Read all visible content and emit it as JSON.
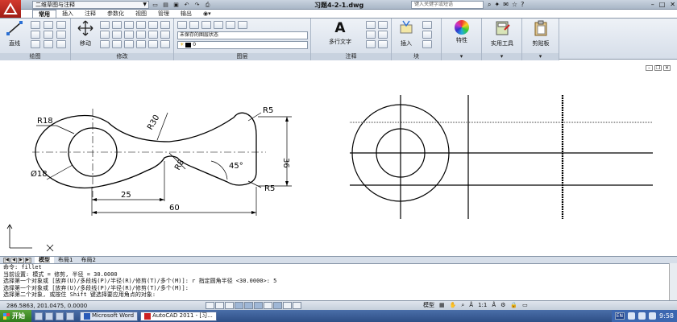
{
  "window": {
    "workspace": "二维草图与注释",
    "doc_title": "习题4-2-1.dwg",
    "search_placeholder": "键入关键字或短语"
  },
  "tabs": [
    {
      "label": "常用",
      "active": true
    },
    {
      "label": "插入",
      "active": false
    },
    {
      "label": "注释",
      "active": false
    },
    {
      "label": "参数化",
      "active": false
    },
    {
      "label": "视图",
      "active": false
    },
    {
      "label": "管理",
      "active": false
    },
    {
      "label": "输出",
      "active": false
    }
  ],
  "ribbon": {
    "draw": {
      "line_label": "直线",
      "panel_label": "绘图"
    },
    "modify": {
      "move_label": "移动",
      "panel_label": "修改"
    },
    "layers": {
      "state_value": "未保存的图层状态",
      "layer_value": "0",
      "panel_label": "图层"
    },
    "annotation": {
      "mtext_label": "多行文字",
      "panel_label": "注释"
    },
    "block": {
      "insert_label": "插入",
      "panel_label": "块"
    },
    "properties_label": "特性",
    "utilities_label": "实用工具",
    "clipboard_label": "剪贴板"
  },
  "drawing": {
    "dims": {
      "r18": "R18",
      "d18": "Ø18",
      "r30": "R30",
      "r8": "R8",
      "r5_top": "R5",
      "r5_bottom": "R5",
      "angle": "45°",
      "h36": "36",
      "w25": "25",
      "w60": "60"
    }
  },
  "layout_tabs": [
    {
      "label": "模型",
      "active": true
    },
    {
      "label": "布局1",
      "active": false
    },
    {
      "label": "布局2",
      "active": false
    }
  ],
  "command_lines": [
    "命令:  fillet",
    "当前设置: 模式 = 修剪, 半径 = 30.0000",
    "选择第一个对象或 [放弃(U)/多段线(P)/半径(R)/修剪(T)/多个(M)]: r 指定圆角半径 <30.0000>: 5",
    "选择第一个对象或 [放弃(U)/多段线(P)/半径(R)/修剪(T)/多个(M)]:",
    "选择第二个对象, 或按住 Shift 键选择要应用角点的对象:"
  ],
  "status": {
    "coords": "286.5863, 201.0475, 0.0000",
    "model_label": "模型",
    "scale": "1:1"
  },
  "taskbar": {
    "start": "开始",
    "task1": "Microsoft Word",
    "task2": "AutoCAD 2011 - [习...",
    "lang": "EN",
    "time": "9:58"
  }
}
